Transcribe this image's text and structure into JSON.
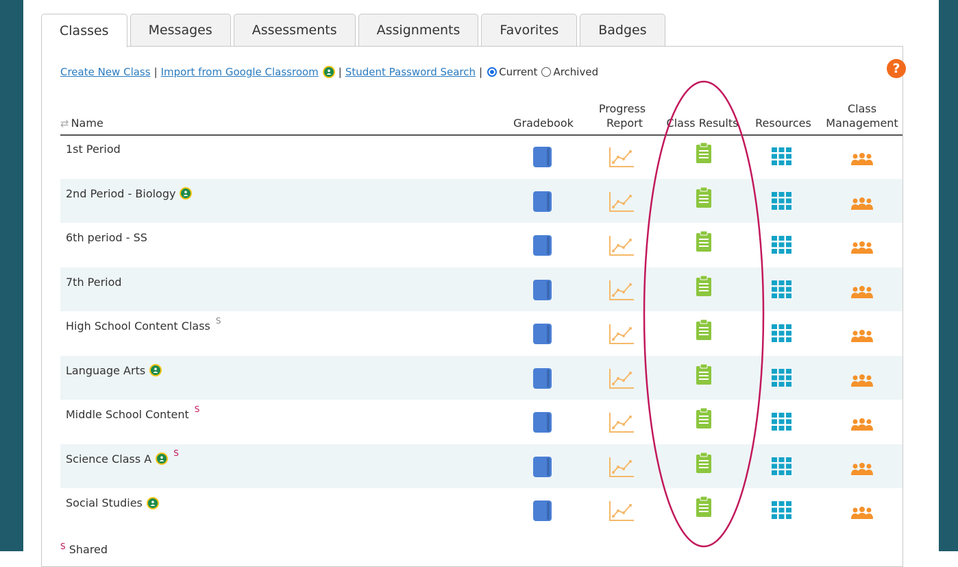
{
  "tabs": [
    {
      "label": "Classes",
      "active": true
    },
    {
      "label": "Messages",
      "active": false
    },
    {
      "label": "Assessments",
      "active": false
    },
    {
      "label": "Assignments",
      "active": false
    },
    {
      "label": "Favorites",
      "active": false
    },
    {
      "label": "Badges",
      "active": false
    }
  ],
  "toolbar": {
    "create_new_class": "Create New Class",
    "import_google": "Import from Google Classroom",
    "student_password_search": "Student Password Search",
    "current_label": "Current",
    "archived_label": "Archived",
    "selected_filter": "Current",
    "separator": "|"
  },
  "help_icon": {
    "glyph": "?",
    "color": "#f26b1d"
  },
  "table": {
    "headers": {
      "name": "Name",
      "gradebook": "Gradebook",
      "progress_report_1": "Progress",
      "progress_report_2": "Report",
      "class_results": "Class Results",
      "resources": "Resources",
      "class_management_1": "Class",
      "class_management_2": "Management"
    },
    "sort_icon": "sort-arrows-icon",
    "rows": [
      {
        "name": "1st Period",
        "google": false,
        "marker": ""
      },
      {
        "name": "2nd Period - Biology",
        "google": true,
        "marker": ""
      },
      {
        "name": "6th period - SS",
        "google": false,
        "marker": ""
      },
      {
        "name": "7th Period",
        "google": false,
        "marker": ""
      },
      {
        "name": "High School Content Class",
        "google": false,
        "marker": "S",
        "marker_style": "plain"
      },
      {
        "name": "Language Arts",
        "google": true,
        "marker": ""
      },
      {
        "name": "Middle School Content",
        "google": false,
        "marker": "S",
        "marker_style": "pink"
      },
      {
        "name": "Science Class A",
        "google": true,
        "marker": "S",
        "marker_style": "pink"
      },
      {
        "name": "Social Studies",
        "google": true,
        "marker": ""
      }
    ]
  },
  "footer": {
    "marker": "S",
    "text": "Shared"
  },
  "colors": {
    "side_bar": "#1f5b6a",
    "link": "#2a7bbf",
    "gradebook": "#4a7fd4",
    "progress": "#f5b869",
    "results": "#8cc63f",
    "resources": "#14a3c7",
    "classmgmt": "#f5922b",
    "annotation": "#c2185b",
    "alt_row": "#eef5f7"
  }
}
